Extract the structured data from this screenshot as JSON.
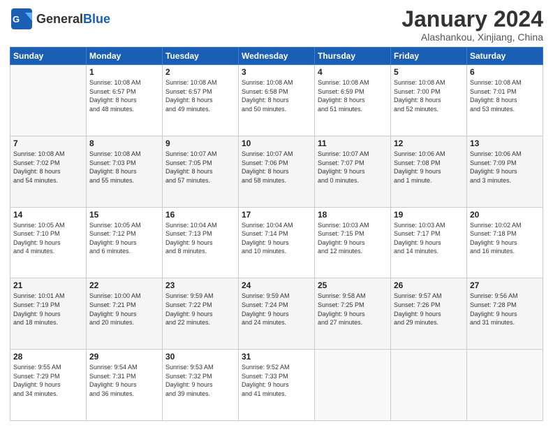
{
  "header": {
    "logo_general": "General",
    "logo_blue": "Blue",
    "month_title": "January 2024",
    "location": "Alashankou, Xinjiang, China"
  },
  "days_of_week": [
    "Sunday",
    "Monday",
    "Tuesday",
    "Wednesday",
    "Thursday",
    "Friday",
    "Saturday"
  ],
  "weeks": [
    [
      {
        "day": "",
        "info": ""
      },
      {
        "day": "1",
        "info": "Sunrise: 10:08 AM\nSunset: 6:57 PM\nDaylight: 8 hours\nand 48 minutes."
      },
      {
        "day": "2",
        "info": "Sunrise: 10:08 AM\nSunset: 6:57 PM\nDaylight: 8 hours\nand 49 minutes."
      },
      {
        "day": "3",
        "info": "Sunrise: 10:08 AM\nSunset: 6:58 PM\nDaylight: 8 hours\nand 50 minutes."
      },
      {
        "day": "4",
        "info": "Sunrise: 10:08 AM\nSunset: 6:59 PM\nDaylight: 8 hours\nand 51 minutes."
      },
      {
        "day": "5",
        "info": "Sunrise: 10:08 AM\nSunset: 7:00 PM\nDaylight: 8 hours\nand 52 minutes."
      },
      {
        "day": "6",
        "info": "Sunrise: 10:08 AM\nSunset: 7:01 PM\nDaylight: 8 hours\nand 53 minutes."
      }
    ],
    [
      {
        "day": "7",
        "info": "Sunrise: 10:08 AM\nSunset: 7:02 PM\nDaylight: 8 hours\nand 54 minutes."
      },
      {
        "day": "8",
        "info": "Sunrise: 10:08 AM\nSunset: 7:03 PM\nDaylight: 8 hours\nand 55 minutes."
      },
      {
        "day": "9",
        "info": "Sunrise: 10:07 AM\nSunset: 7:05 PM\nDaylight: 8 hours\nand 57 minutes."
      },
      {
        "day": "10",
        "info": "Sunrise: 10:07 AM\nSunset: 7:06 PM\nDaylight: 8 hours\nand 58 minutes."
      },
      {
        "day": "11",
        "info": "Sunrise: 10:07 AM\nSunset: 7:07 PM\nDaylight: 9 hours\nand 0 minutes."
      },
      {
        "day": "12",
        "info": "Sunrise: 10:06 AM\nSunset: 7:08 PM\nDaylight: 9 hours\nand 1 minute."
      },
      {
        "day": "13",
        "info": "Sunrise: 10:06 AM\nSunset: 7:09 PM\nDaylight: 9 hours\nand 3 minutes."
      }
    ],
    [
      {
        "day": "14",
        "info": "Sunrise: 10:05 AM\nSunset: 7:10 PM\nDaylight: 9 hours\nand 4 minutes."
      },
      {
        "day": "15",
        "info": "Sunrise: 10:05 AM\nSunset: 7:12 PM\nDaylight: 9 hours\nand 6 minutes."
      },
      {
        "day": "16",
        "info": "Sunrise: 10:04 AM\nSunset: 7:13 PM\nDaylight: 9 hours\nand 8 minutes."
      },
      {
        "day": "17",
        "info": "Sunrise: 10:04 AM\nSunset: 7:14 PM\nDaylight: 9 hours\nand 10 minutes."
      },
      {
        "day": "18",
        "info": "Sunrise: 10:03 AM\nSunset: 7:15 PM\nDaylight: 9 hours\nand 12 minutes."
      },
      {
        "day": "19",
        "info": "Sunrise: 10:03 AM\nSunset: 7:17 PM\nDaylight: 9 hours\nand 14 minutes."
      },
      {
        "day": "20",
        "info": "Sunrise: 10:02 AM\nSunset: 7:18 PM\nDaylight: 9 hours\nand 16 minutes."
      }
    ],
    [
      {
        "day": "21",
        "info": "Sunrise: 10:01 AM\nSunset: 7:19 PM\nDaylight: 9 hours\nand 18 minutes."
      },
      {
        "day": "22",
        "info": "Sunrise: 10:00 AM\nSunset: 7:21 PM\nDaylight: 9 hours\nand 20 minutes."
      },
      {
        "day": "23",
        "info": "Sunrise: 9:59 AM\nSunset: 7:22 PM\nDaylight: 9 hours\nand 22 minutes."
      },
      {
        "day": "24",
        "info": "Sunrise: 9:59 AM\nSunset: 7:24 PM\nDaylight: 9 hours\nand 24 minutes."
      },
      {
        "day": "25",
        "info": "Sunrise: 9:58 AM\nSunset: 7:25 PM\nDaylight: 9 hours\nand 27 minutes."
      },
      {
        "day": "26",
        "info": "Sunrise: 9:57 AM\nSunset: 7:26 PM\nDaylight: 9 hours\nand 29 minutes."
      },
      {
        "day": "27",
        "info": "Sunrise: 9:56 AM\nSunset: 7:28 PM\nDaylight: 9 hours\nand 31 minutes."
      }
    ],
    [
      {
        "day": "28",
        "info": "Sunrise: 9:55 AM\nSunset: 7:29 PM\nDaylight: 9 hours\nand 34 minutes."
      },
      {
        "day": "29",
        "info": "Sunrise: 9:54 AM\nSunset: 7:31 PM\nDaylight: 9 hours\nand 36 minutes."
      },
      {
        "day": "30",
        "info": "Sunrise: 9:53 AM\nSunset: 7:32 PM\nDaylight: 9 hours\nand 39 minutes."
      },
      {
        "day": "31",
        "info": "Sunrise: 9:52 AM\nSunset: 7:33 PM\nDaylight: 9 hours\nand 41 minutes."
      },
      {
        "day": "",
        "info": ""
      },
      {
        "day": "",
        "info": ""
      },
      {
        "day": "",
        "info": ""
      }
    ]
  ]
}
